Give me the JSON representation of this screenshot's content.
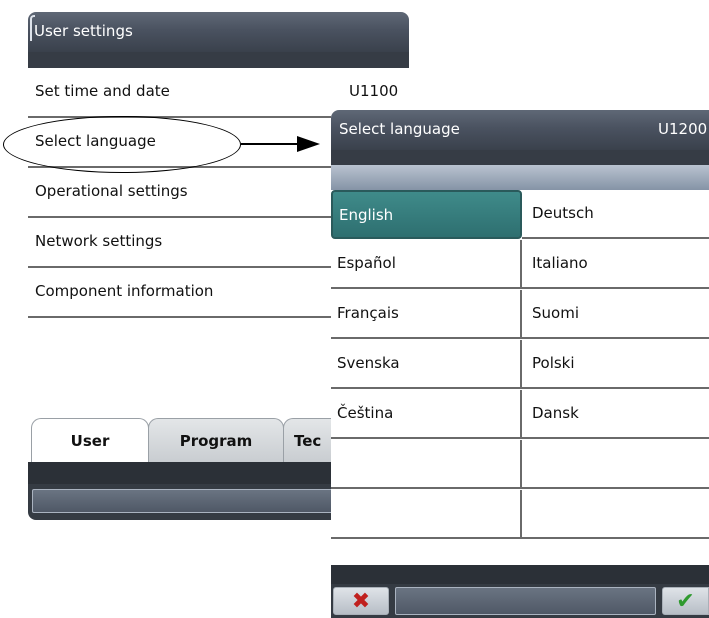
{
  "user_settings": {
    "title": "User settings",
    "menu": [
      {
        "label": "Set time and date",
        "code": "U1100"
      },
      {
        "label": "Select language",
        "code": ""
      },
      {
        "label": "Operational settings",
        "code": ""
      },
      {
        "label": "Network settings",
        "code": ""
      },
      {
        "label": "Component information",
        "code": ""
      }
    ],
    "tabs": [
      {
        "label": "User",
        "active": true
      },
      {
        "label": "Program",
        "active": false
      },
      {
        "label": "Tec",
        "active": false
      }
    ]
  },
  "select_language": {
    "title": "Select language",
    "code": "U1200",
    "languages": [
      {
        "label": "English",
        "selected": true
      },
      {
        "label": "Deutsch",
        "selected": false
      },
      {
        "label": "Español",
        "selected": false
      },
      {
        "label": "Italiano",
        "selected": false
      },
      {
        "label": "Français",
        "selected": false
      },
      {
        "label": "Suomi",
        "selected": false
      },
      {
        "label": "Svenska",
        "selected": false
      },
      {
        "label": "Polski",
        "selected": false
      },
      {
        "label": "Čeština",
        "selected": false
      },
      {
        "label": "Dansk",
        "selected": false
      }
    ],
    "buttons": {
      "cancel_icon": "✖",
      "ok_icon": "✔"
    }
  },
  "colors": {
    "title_bar": "#4a5260",
    "selected_cell": "#3f8b8a",
    "cancel": "#c0201e",
    "ok": "#2f9a2f"
  }
}
